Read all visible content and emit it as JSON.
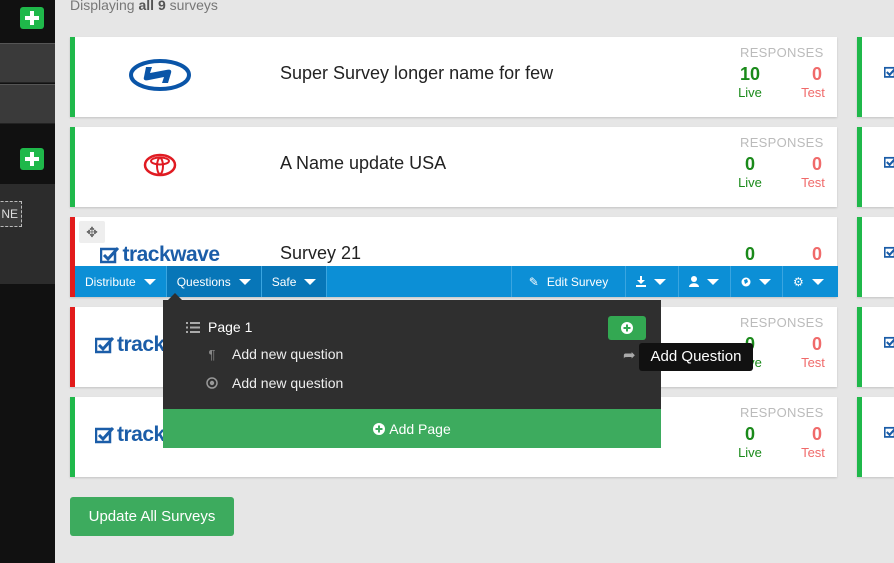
{
  "summary": {
    "prefix": "Displaying",
    "count_text": "all 9",
    "suffix": "surveys"
  },
  "sidebar": {
    "truncated_label": "NE"
  },
  "surveys": [
    {
      "logo": "hyundai-logo",
      "name": "Super Survey longer name for few",
      "responses_label": "RESPONSES",
      "live": "10",
      "live_label": "Live",
      "test": "0",
      "test_label": "Test",
      "status_color": "#1fb84a"
    },
    {
      "logo": "toyota-logo",
      "name": "A Name update USA",
      "responses_label": "RESPONSES",
      "live": "0",
      "live_label": "Live",
      "test": "0",
      "test_label": "Test",
      "status_color": "#1fb84a"
    },
    {
      "logo": "trackwave-logo",
      "logo_text": "trackwave",
      "name": "Survey 21",
      "live": "0",
      "test": "0",
      "status_color": "#e21b1b"
    },
    {
      "logo": "trackwave-logo",
      "logo_text": "track",
      "responses_label": "RESPONSES",
      "live": "0",
      "live_label": "Live",
      "test": "0",
      "test_label": "Test",
      "status_color": "#e21b1b"
    },
    {
      "logo": "trackwave-logo",
      "logo_text": "track",
      "responses_label": "RESPONSES",
      "live": "0",
      "live_label": "Live",
      "test": "0",
      "test_label": "Test",
      "status_color": "#1fb84a"
    }
  ],
  "toolbar": {
    "distribute": "Distribute",
    "questions": "Questions",
    "safe": "Safe",
    "edit_survey": "Edit Survey"
  },
  "questions_menu": {
    "page_label": "Page 1",
    "items": [
      "Add new question",
      "Add new question"
    ],
    "add_page": "Add Page"
  },
  "tooltip": "Add Question",
  "update_button": "Update All Surveys",
  "colors": {
    "accent_blue": "#0c8fd6",
    "success_green": "#3dab5e",
    "live_green": "#1a8a1a",
    "test_red": "#f06a6a"
  }
}
